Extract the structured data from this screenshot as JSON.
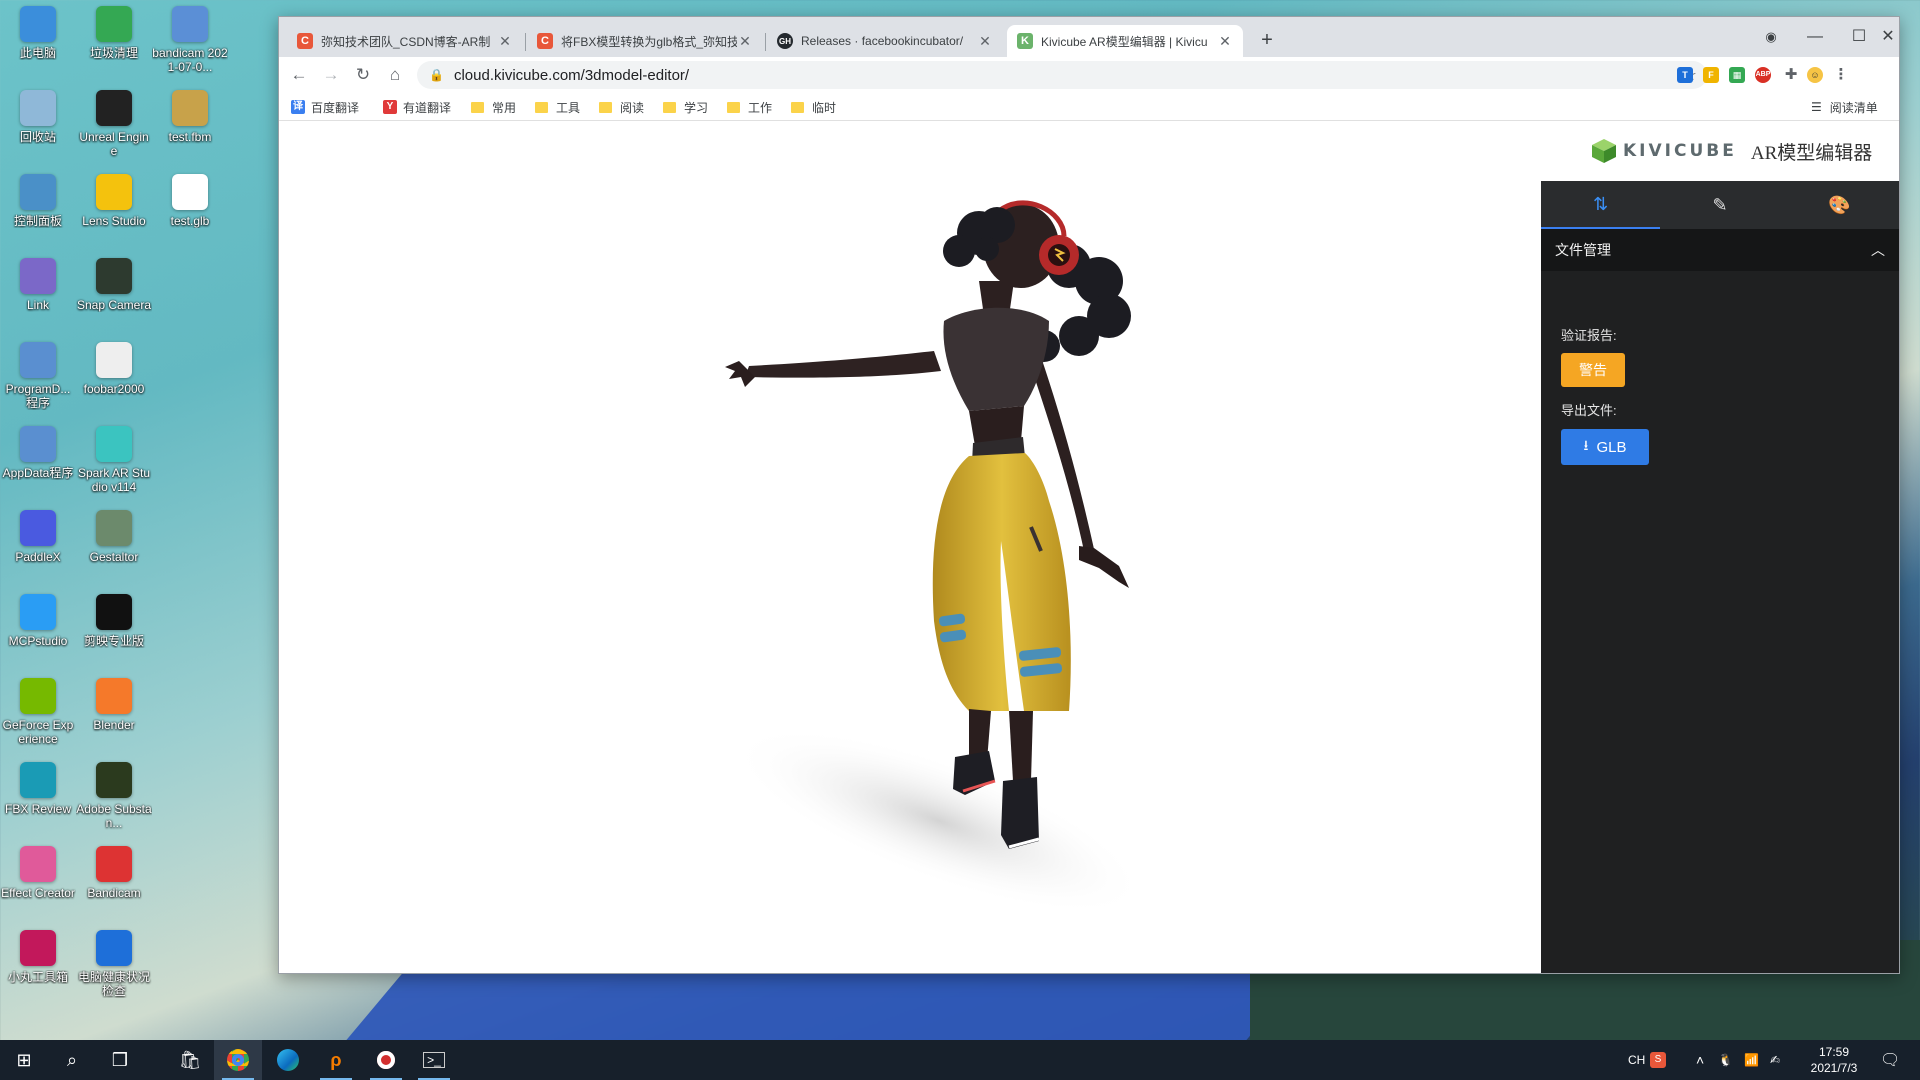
{
  "desktop": {
    "icons": [
      {
        "label": "此电脑",
        "color": "#3b8edb"
      },
      {
        "label": "垃圾清理",
        "color": "#34a853"
      },
      {
        "label": "bandicam 2021-07-0...",
        "color": "#5b8fd6"
      },
      {
        "label": "回收站",
        "color": "#8fb8d8"
      },
      {
        "label": "Unreal Engine",
        "color": "#222222"
      },
      {
        "label": "test.fbm",
        "color": "#c8a24a"
      },
      {
        "label": "控制面板",
        "color": "#4a90c8"
      },
      {
        "label": "Lens Studio",
        "color": "#f4c20d"
      },
      {
        "label": "test.glb",
        "color": "#ffffff"
      },
      {
        "label": "Link",
        "color": "#7b68c8"
      },
      {
        "label": "Snap Camera",
        "color": "#2d3a2f"
      },
      {
        "label": "ProgramD... 程序",
        "color": "#5a8fd0"
      },
      {
        "label": "foobar2000",
        "color": "#eeeeee"
      },
      {
        "label": "AppData程序",
        "color": "#5a8fd0"
      },
      {
        "label": "Spark AR Studio v114",
        "color": "#3bc4c0"
      },
      {
        "label": "PaddleX",
        "color": "#4a5ae0"
      },
      {
        "label": "Gestaltor",
        "color": "#6c8a6c"
      },
      {
        "label": "MCPstudio",
        "color": "#2a9df4"
      },
      {
        "label": "剪映专业版",
        "color": "#111111"
      },
      {
        "label": "GeForce Experience",
        "color": "#76b900"
      },
      {
        "label": "Blender",
        "color": "#f5792a"
      },
      {
        "label": "FBX Review",
        "color": "#1a9bb5"
      },
      {
        "label": "Adobe Substan...",
        "color": "#2b3a1e"
      },
      {
        "label": "Effect Creator",
        "color": "#e05a9a"
      },
      {
        "label": "Bandicam",
        "color": "#d33"
      },
      {
        "label": "小丸工具箱",
        "color": "#c2185b"
      },
      {
        "label": "电脑健康状况检查",
        "color": "#1e6fd9"
      }
    ]
  },
  "browser": {
    "tabs": [
      {
        "title": "弥知技术团队_CSDN博客-AR制",
        "favicon": "C",
        "favicon_color": "#e8573a"
      },
      {
        "title": "将FBX模型转换为glb格式_弥知技",
        "favicon": "C",
        "favicon_color": "#e8573a"
      },
      {
        "title": "Releases · facebookincubator/",
        "favicon": "GH",
        "favicon_color": "#24292e"
      },
      {
        "title": "Kivicube AR模型编辑器 | Kivicu",
        "favicon": "K",
        "favicon_color": "#6bb36b"
      }
    ],
    "url": "cloud.kivicube.com/3dmodel-editor/",
    "bookmarks": [
      {
        "label": "百度翻译",
        "type": "site",
        "color": "#3a7ff0",
        "glyph": "译"
      },
      {
        "label": "有道翻译",
        "type": "site",
        "color": "#e03a3a",
        "glyph": "Y"
      },
      {
        "label": "常用",
        "type": "folder"
      },
      {
        "label": "工具",
        "type": "folder"
      },
      {
        "label": "阅读",
        "type": "folder"
      },
      {
        "label": "学习",
        "type": "folder"
      },
      {
        "label": "工作",
        "type": "folder"
      },
      {
        "label": "临时",
        "type": "folder"
      }
    ],
    "reading_list": "阅读清单"
  },
  "editor": {
    "brand": "KIVICUBE",
    "subtitle": "AR模型编辑器",
    "section_title": "文件管理",
    "validation_label": "验证报告:",
    "validation_button": "警告",
    "export_label": "导出文件:",
    "export_button": "GLB",
    "colors": {
      "warning": "#f5a623",
      "primary": "#2f7be5",
      "panel_bg": "#1f2021"
    }
  },
  "taskbar": {
    "ime": "CH",
    "time": "17:59",
    "date": "2021/7/3"
  }
}
